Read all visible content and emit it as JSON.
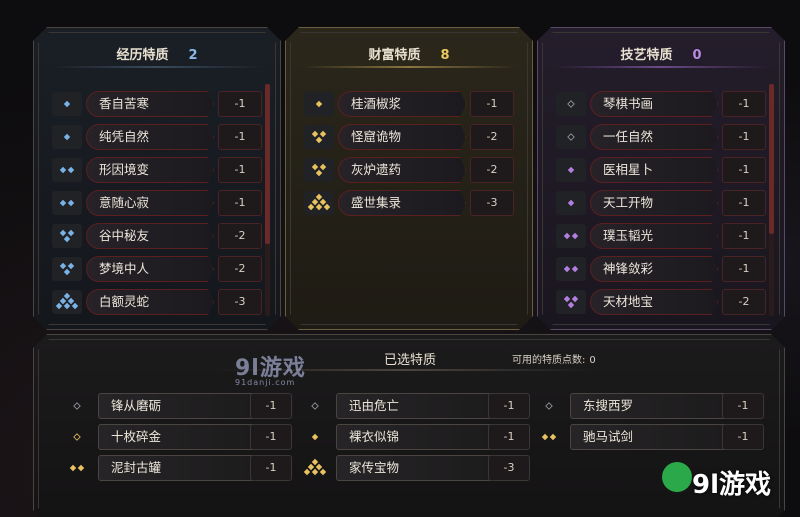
{
  "colors": {
    "experience": "#7ab2e6",
    "wealth": "#e8c260",
    "skill": "#b47ee0"
  },
  "panels": {
    "experience": {
      "title": "经历特质",
      "count": "2",
      "traits": [
        {
          "name": "香自苦寒",
          "cost": "-1",
          "icon": "diamond-1-blue"
        },
        {
          "name": "纯凭自然",
          "cost": "-1",
          "icon": "diamond-1-blue"
        },
        {
          "name": "形因境变",
          "cost": "-1",
          "icon": "diamond-2-blue"
        },
        {
          "name": "意随心寂",
          "cost": "-1",
          "icon": "diamond-2-blue"
        },
        {
          "name": "谷中秘友",
          "cost": "-2",
          "icon": "diamond-3-blue"
        },
        {
          "name": "梦境中人",
          "cost": "-2",
          "icon": "diamond-3-blue"
        },
        {
          "name": "白额灵蛇",
          "cost": "-3",
          "icon": "diamond-6-blue"
        }
      ]
    },
    "wealth": {
      "title": "财富特质",
      "count": "8",
      "traits": [
        {
          "name": "桂酒椒浆",
          "cost": "-1",
          "icon": "diamond-1-gold"
        },
        {
          "name": "怪窟诡物",
          "cost": "-2",
          "icon": "diamond-3-gold"
        },
        {
          "name": "灰炉遗药",
          "cost": "-2",
          "icon": "diamond-3-gold"
        },
        {
          "name": "盛世集录",
          "cost": "-3",
          "icon": "diamond-6-gold"
        }
      ]
    },
    "skill": {
      "title": "技艺特质",
      "count": "0",
      "traits": [
        {
          "name": "琴棋书画",
          "cost": "-1",
          "icon": "diamond-1-outline"
        },
        {
          "name": "一任自然",
          "cost": "-1",
          "icon": "diamond-1-outline"
        },
        {
          "name": "医相星卜",
          "cost": "-1",
          "icon": "diamond-1-purple"
        },
        {
          "name": "天工开物",
          "cost": "-1",
          "icon": "diamond-1-purple"
        },
        {
          "name": "璞玉韬光",
          "cost": "-1",
          "icon": "diamond-2-purple"
        },
        {
          "name": "神锋敛彩",
          "cost": "-1",
          "icon": "diamond-2-purple"
        },
        {
          "name": "天材地宝",
          "cost": "-2",
          "icon": "diamond-3-purple"
        }
      ]
    }
  },
  "selected": {
    "title": "已选特质",
    "points_label": "可用的特质点数:",
    "points_value": "0",
    "traits": [
      {
        "name": "锋从磨砺",
        "cost": "-1",
        "icon": "diamond-1-outline"
      },
      {
        "name": "十枚碎金",
        "cost": "-1",
        "icon": "diamond-1-outline-gold"
      },
      {
        "name": "泥封古罐",
        "cost": "-1",
        "icon": "diamond-2-gold"
      },
      {
        "name": "迅由危亡",
        "cost": "-1",
        "icon": "diamond-1-outline"
      },
      {
        "name": "裸衣似锦",
        "cost": "-1",
        "icon": "diamond-1-gold"
      },
      {
        "name": "家传宝物",
        "cost": "-3",
        "icon": "diamond-6-gold"
      },
      {
        "name": "东搜西罗",
        "cost": "-1",
        "icon": "diamond-1-outline"
      },
      {
        "name": "驰马试剑",
        "cost": "-1",
        "icon": "diamond-2-gold"
      }
    ]
  },
  "watermark": {
    "mark": "9l游戏",
    "url": "91danji.com",
    "logo_text": "9l游戏"
  }
}
